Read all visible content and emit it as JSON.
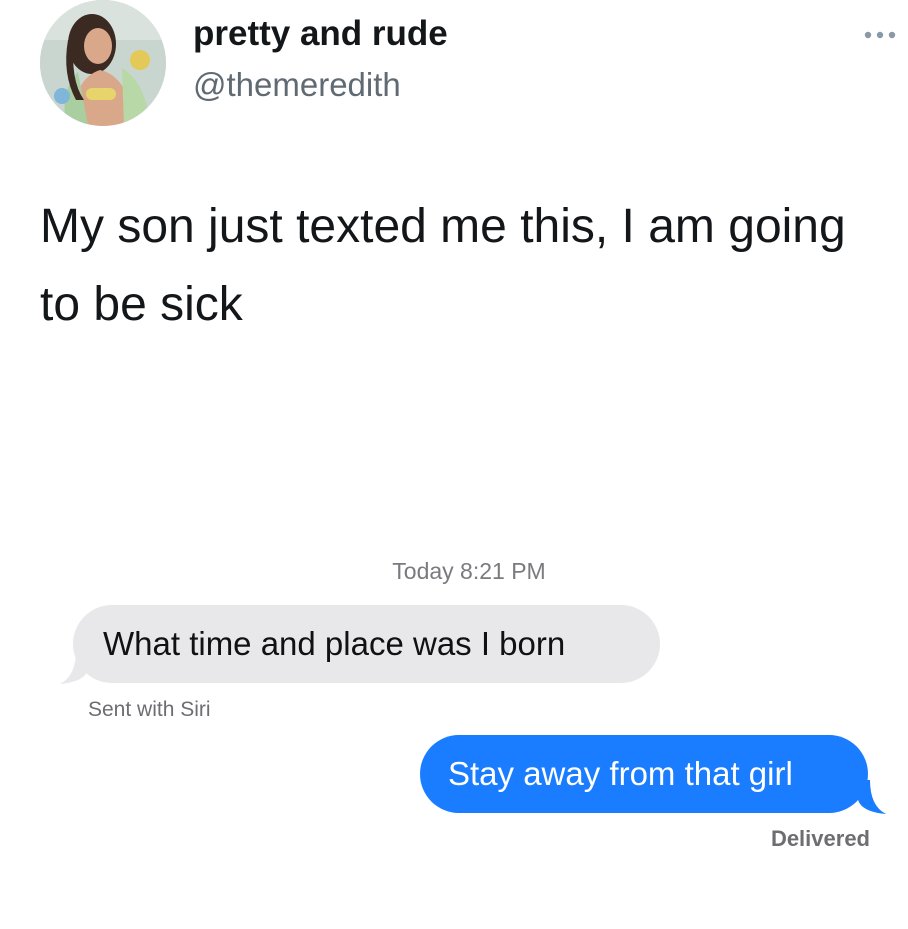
{
  "tweet": {
    "display_name": "pretty and rude",
    "handle": "@themeredith",
    "text": "My son just texted me this, I am going to be sick",
    "more_icon": "ellipsis-icon",
    "avatar_icon": "profile-photo"
  },
  "conversation": {
    "timestamp": "Today 8:21 PM",
    "incoming_message": "What time and place was I born",
    "incoming_note": "Sent with Siri",
    "outgoing_message": "Stay away from that girl",
    "outgoing_status": "Delivered",
    "colors": {
      "incoming_bubble": "#e8e8ea",
      "outgoing_bubble": "#1a7cff",
      "outgoing_text": "#ffffff"
    }
  }
}
